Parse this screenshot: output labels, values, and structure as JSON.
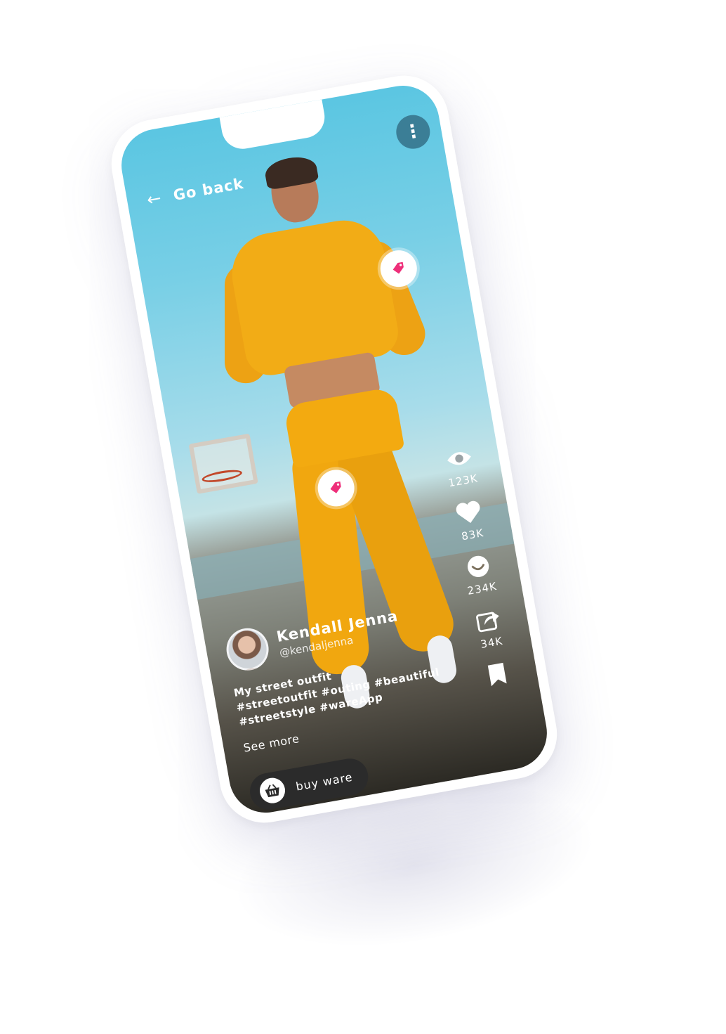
{
  "header": {
    "back_label": "Go back"
  },
  "post": {
    "author_name": "Kendall Jenna",
    "author_handle": "@kendaljenna",
    "caption_line1": "My street outfit",
    "caption_line2": "#streetoutfit  #outing #beautiful",
    "caption_line3": "#streetstyle #wareApp",
    "see_more": "See more"
  },
  "stats": {
    "views": "123K",
    "likes": "83K",
    "comments": "234K",
    "shares": "34K"
  },
  "actions": {
    "buy_label": "buy ware"
  },
  "colors": {
    "tag_pink": "#ee2f7a",
    "button_dark": "#2b2b2b",
    "menu_button": "#3b7e96"
  }
}
